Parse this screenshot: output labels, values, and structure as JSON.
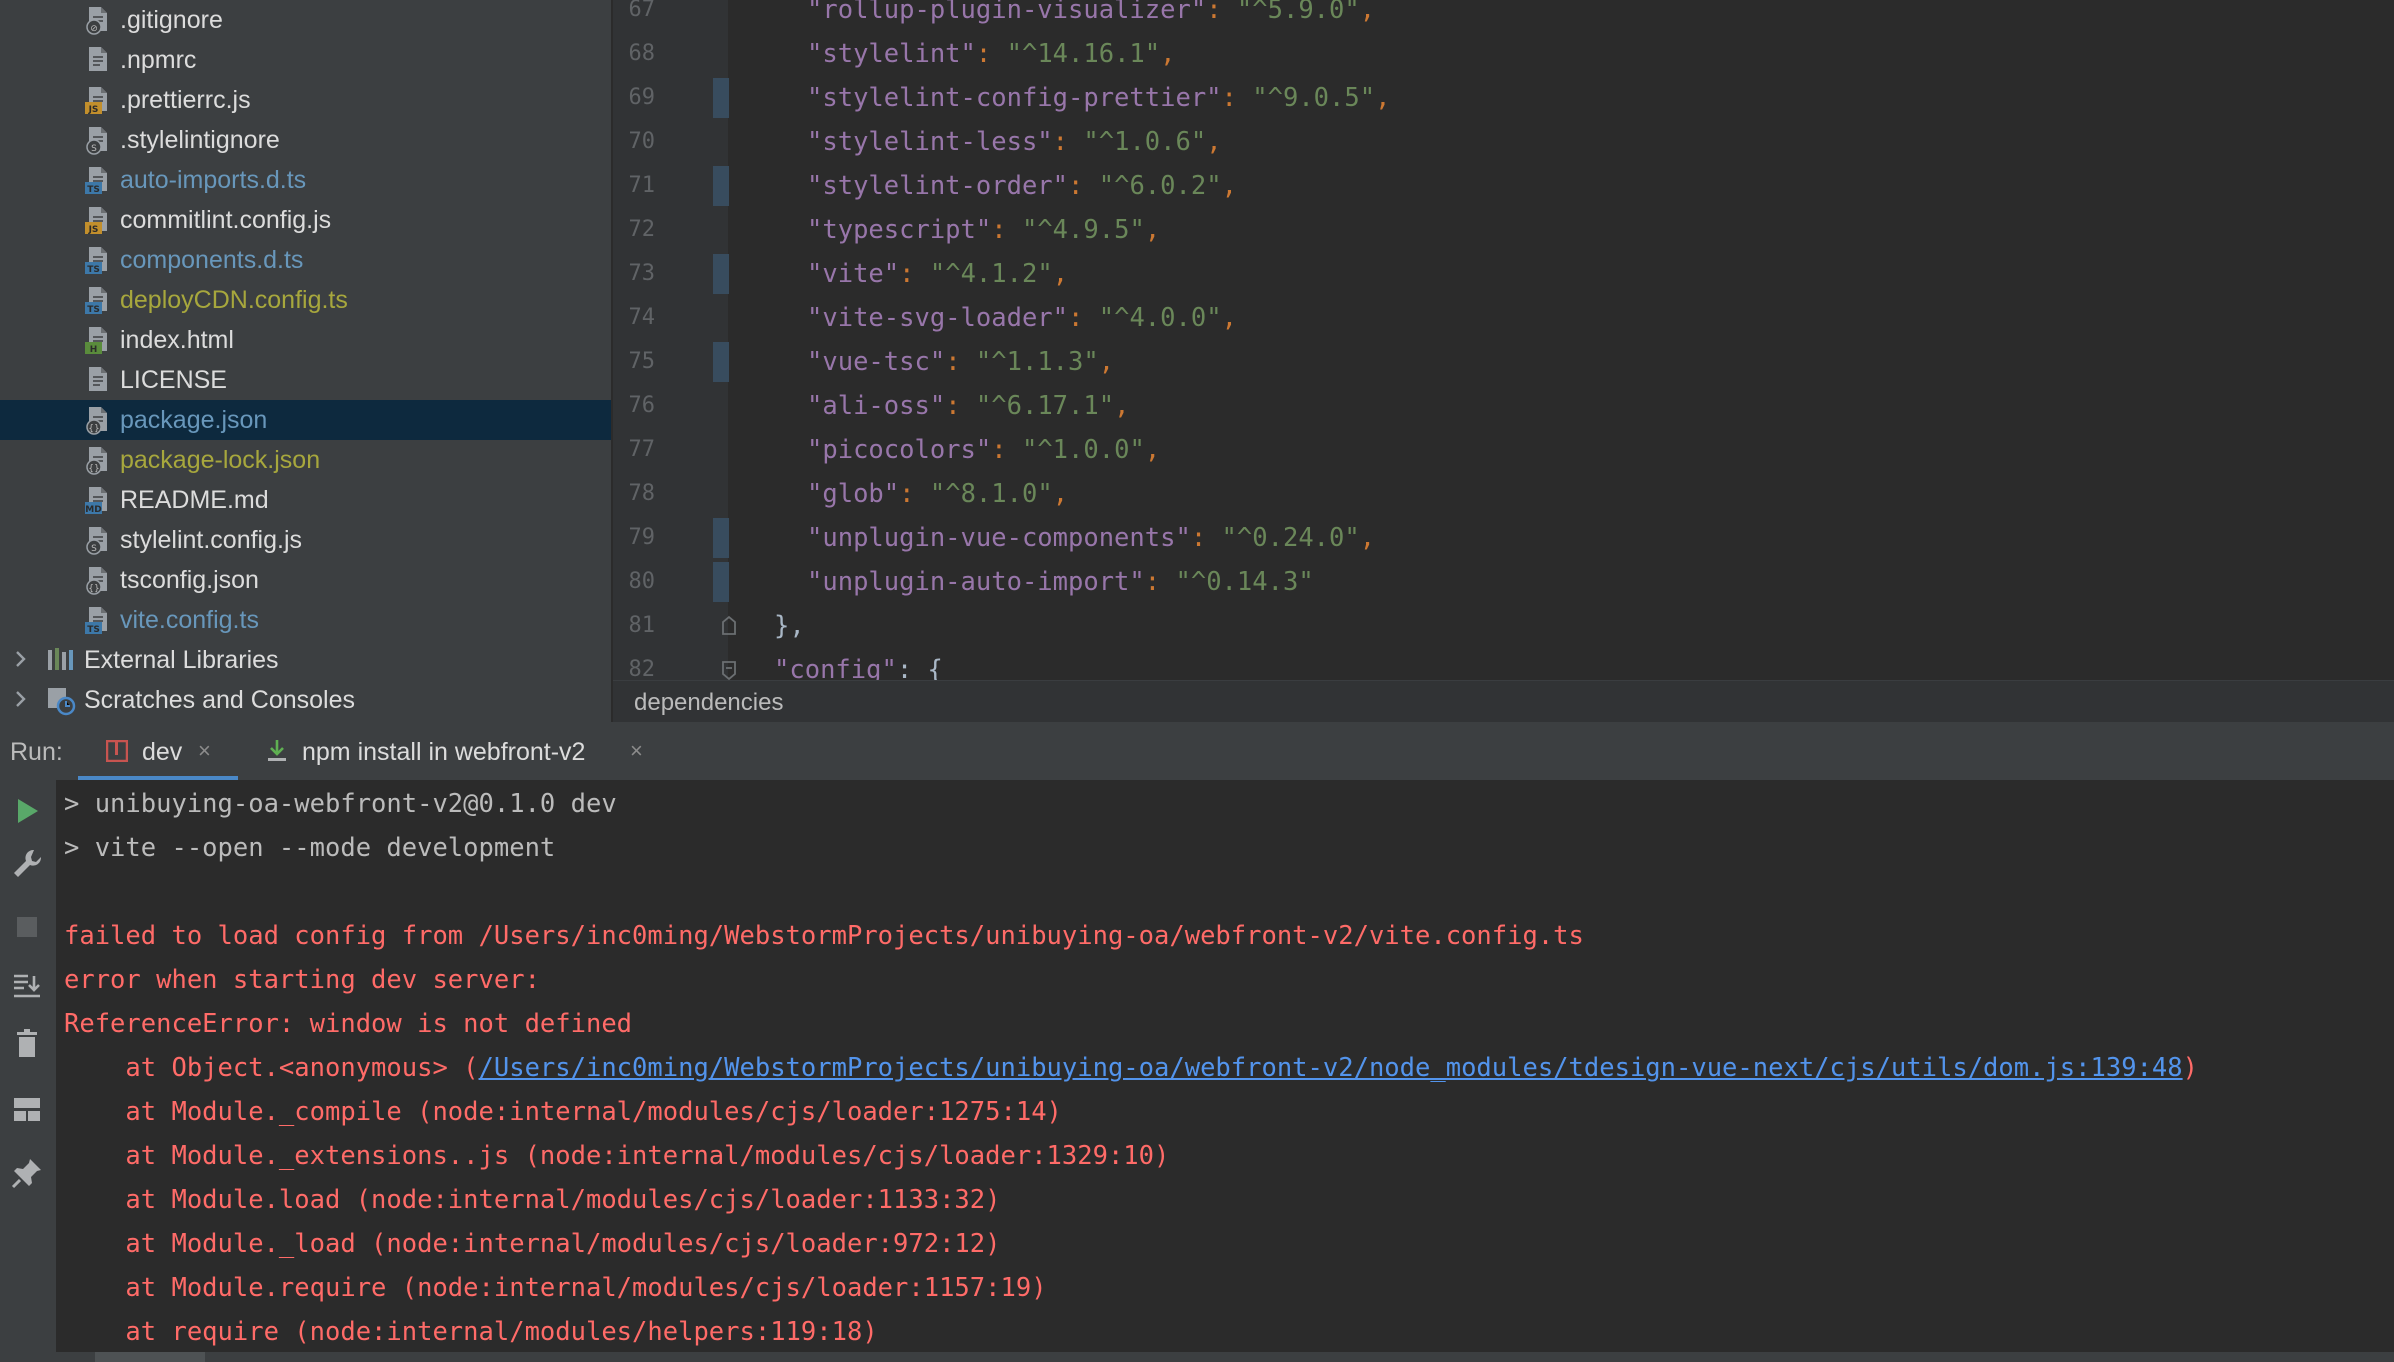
{
  "project_tree": {
    "files": [
      {
        "name": ".gitignore",
        "icon": "ignore-file-icon",
        "color": "#dcdcdc"
      },
      {
        "name": ".npmrc",
        "icon": "text-file-icon",
        "color": "#dcdcdc"
      },
      {
        "name": ".prettierrc.js",
        "icon": "js-file-icon",
        "color": "#dcdcdc"
      },
      {
        "name": ".stylelintignore",
        "icon": "stylelint-file-icon",
        "color": "#dcdcdc"
      },
      {
        "name": "auto-imports.d.ts",
        "icon": "ts-file-icon",
        "color": "#6897bb"
      },
      {
        "name": "commitlint.config.js",
        "icon": "js-file-icon",
        "color": "#dcdcdc"
      },
      {
        "name": "components.d.ts",
        "icon": "ts-file-icon",
        "color": "#6897bb"
      },
      {
        "name": "deployCDN.config.ts",
        "icon": "ts-file-icon",
        "color": "#a7a73d"
      },
      {
        "name": "index.html",
        "icon": "html-file-icon",
        "color": "#dcdcdc"
      },
      {
        "name": "LICENSE",
        "icon": "text-file-icon",
        "color": "#dcdcdc"
      },
      {
        "name": "package.json",
        "icon": "json-file-icon",
        "color": "#6897bb",
        "selected": true
      },
      {
        "name": "package-lock.json",
        "icon": "json-file-icon",
        "color": "#a7a73d"
      },
      {
        "name": "README.md",
        "icon": "md-file-icon",
        "color": "#dcdcdc"
      },
      {
        "name": "stylelint.config.js",
        "icon": "stylelint-file-icon",
        "color": "#dcdcdc"
      },
      {
        "name": "tsconfig.json",
        "icon": "json-file-icon",
        "color": "#dcdcdc"
      },
      {
        "name": "vite.config.ts",
        "icon": "ts-file-icon",
        "color": "#6897bb"
      }
    ],
    "external_libraries": "External Libraries",
    "scratches": "Scratches and Consoles"
  },
  "editor": {
    "lines": [
      {
        "num": "67",
        "key": "rollup-plugin-visualizer",
        "value": "^5.9.0",
        "comma": true
      },
      {
        "num": "68",
        "key": "stylelint",
        "value": "^14.16.1",
        "comma": true
      },
      {
        "num": "69",
        "key": "stylelint-config-prettier",
        "value": "^9.0.5",
        "comma": true
      },
      {
        "num": "70",
        "key": "stylelint-less",
        "value": "^1.0.6",
        "comma": true
      },
      {
        "num": "71",
        "key": "stylelint-order",
        "value": "^6.0.2",
        "comma": true
      },
      {
        "num": "72",
        "key": "typescript",
        "value": "^4.9.5",
        "comma": true
      },
      {
        "num": "73",
        "key": "vite",
        "value": "^4.1.2",
        "comma": true
      },
      {
        "num": "74",
        "key": "vite-svg-loader",
        "value": "^4.0.0",
        "comma": true
      },
      {
        "num": "75",
        "key": "vue-tsc",
        "value": "^1.1.3",
        "comma": true
      },
      {
        "num": "76",
        "key": "ali-oss",
        "value": "^6.17.1",
        "comma": true
      },
      {
        "num": "77",
        "key": "picocolors",
        "value": "^1.0.0",
        "comma": true
      },
      {
        "num": "78",
        "key": "glob",
        "value": "^8.1.0",
        "comma": true
      },
      {
        "num": "79",
        "key": "unplugin-vue-components",
        "value": "^0.24.0",
        "comma": true
      },
      {
        "num": "80",
        "key": "unplugin-auto-import",
        "value": "^0.14.3",
        "comma": false
      }
    ],
    "line_81": {
      "num": "81",
      "text": "},"
    },
    "line_82": {
      "num": "82",
      "key": "config",
      "after": ": {"
    },
    "breadcrumb": "dependencies"
  },
  "run_panel": {
    "title": "Run:",
    "tabs": [
      {
        "label": "dev",
        "active": true
      },
      {
        "label": "npm install in webfront-v2",
        "active": false
      }
    ],
    "close_glyph": "×"
  },
  "console": {
    "lines": [
      {
        "text": "> unibuying-oa-webfront-v2@0.1.0 dev",
        "kind": "normal"
      },
      {
        "text": "> vite --open --mode development",
        "kind": "normal"
      },
      {
        "text": "",
        "kind": "normal"
      },
      {
        "text": "failed to load config from /Users/inc0ming/WebstormProjects/unibuying-oa/webfront-v2/vite.config.ts",
        "kind": "error"
      },
      {
        "text": "error when starting dev server:",
        "kind": "error"
      },
      {
        "text": "ReferenceError: window is not defined",
        "kind": "error"
      },
      {
        "prefix": "    at Object.<anonymous> (",
        "link": "/Users/inc0ming/WebstormProjects/unibuying-oa/webfront-v2/node_modules/tdesign-vue-next/cjs/utils/dom.js:139:48",
        "suffix": ")",
        "kind": "error-link"
      },
      {
        "text": "    at Module._compile (node:internal/modules/cjs/loader:1275:14)",
        "kind": "error"
      },
      {
        "text": "    at Module._extensions..js (node:internal/modules/cjs/loader:1329:10)",
        "kind": "error"
      },
      {
        "text": "    at Module.load (node:internal/modules/cjs/loader:1133:32)",
        "kind": "error"
      },
      {
        "text": "    at Module._load (node:internal/modules/cjs/loader:972:12)",
        "kind": "error"
      },
      {
        "text": "    at Module.require (node:internal/modules/cjs/loader:1157:19)",
        "kind": "error"
      },
      {
        "text": "    at require (node:internal/modules/helpers:119:18)",
        "kind": "error"
      }
    ]
  },
  "colors": {
    "tree_bg": "#3c3f41",
    "editor_bg": "#2b2b2b",
    "json_key": "#9876aa",
    "json_string": "#6a8759",
    "error_text": "#ff6b68",
    "link": "#5394ec",
    "accent": "#4a88c7"
  }
}
